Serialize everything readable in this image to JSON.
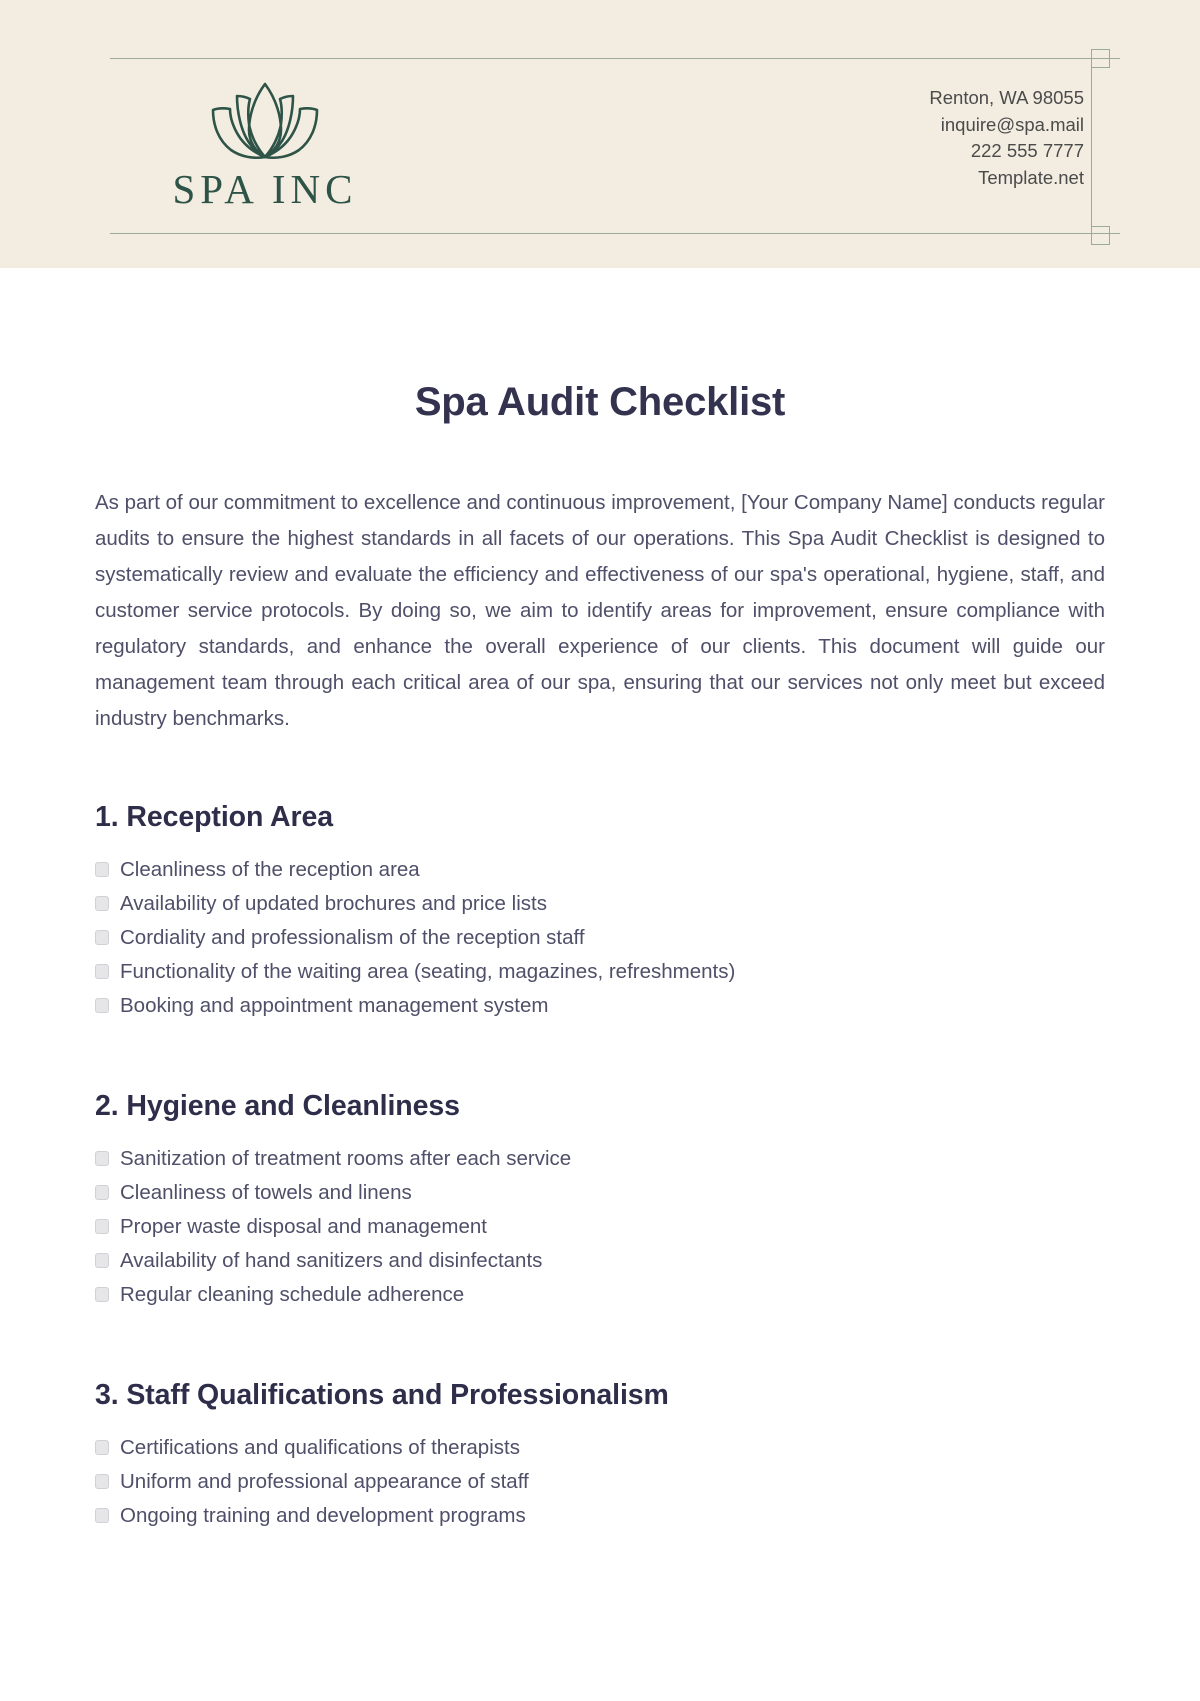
{
  "header": {
    "logo": {
      "mark": "lotus-flower-icon",
      "wordmark": "SPA INC"
    },
    "contact": [
      "Renton, WA 98055",
      "inquire@spa.mail",
      "222 555 7777",
      "Template.net"
    ]
  },
  "document": {
    "title": "Spa Audit Checklist",
    "intro": "As part of our commitment to excellence and continuous improvement, [Your Company Name] conducts regular audits to ensure the highest standards in all facets of our operations. This Spa Audit Checklist is designed to systematically review and evaluate the efficiency and effectiveness of our spa's operational, hygiene, staff, and customer service protocols. By doing so, we aim to identify areas for improvement, ensure compliance with regulatory standards, and enhance the overall experience of our clients. This document will guide our management team through each critical area of our spa, ensuring that our services not only meet but exceed industry benchmarks.",
    "sections": [
      {
        "heading": "1. Reception Area",
        "items": [
          "Cleanliness of the reception area",
          "Availability of updated brochures and price lists",
          "Cordiality and professionalism of the reception staff",
          "Functionality of the waiting area (seating, magazines, refreshments)",
          "Booking and appointment management system"
        ]
      },
      {
        "heading": "2. Hygiene and Cleanliness",
        "items": [
          "Sanitization of treatment rooms after each service",
          "Cleanliness of towels and linens",
          "Proper waste disposal and management",
          "Availability of hand sanitizers and disinfectants",
          "Regular cleaning schedule adherence"
        ]
      },
      {
        "heading": "3. Staff Qualifications and Professionalism",
        "items": [
          "Certifications and qualifications of therapists",
          "Uniform and professional appearance of staff",
          "Ongoing training and development programs"
        ]
      }
    ]
  },
  "colors": {
    "header_background": "#f3ede1",
    "brand_green": "#2e5347",
    "rule_green": "#9aab9c",
    "title_navy": "#33334f",
    "body_text": "#4f4f69",
    "checkbox_fill": "#e6e6e8"
  }
}
